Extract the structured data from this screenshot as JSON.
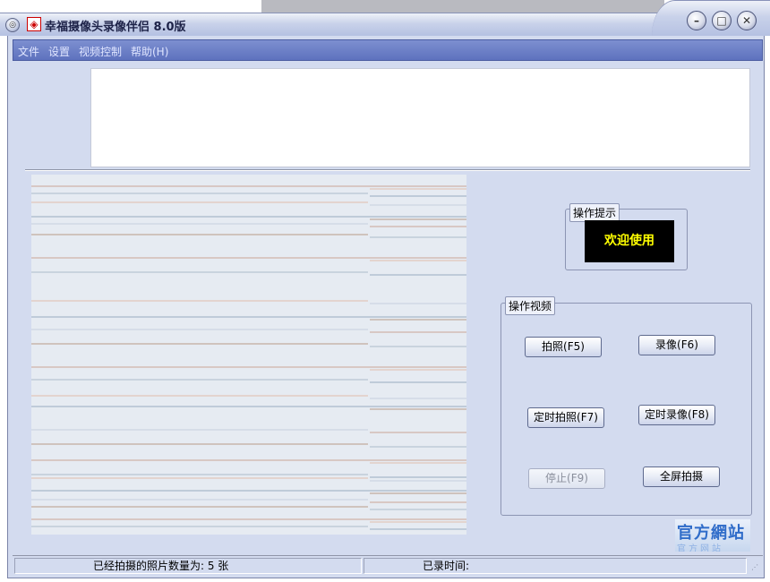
{
  "window": {
    "title": "幸福摄像头录像伴侣 8.0版",
    "app_icon": "◈",
    "system_menu_icon": "◎",
    "controls": {
      "minimize": "–",
      "maximize": "□",
      "close": "✕"
    }
  },
  "menu": {
    "items": [
      {
        "label": "文件"
      },
      {
        "label": "设置"
      },
      {
        "label": "视频控制"
      },
      {
        "label": "帮助(H)"
      }
    ]
  },
  "hint_panel": {
    "title": "操作提示",
    "message": "欢迎使用",
    "message_color": "#ffff00",
    "background_color": "#000000"
  },
  "video_panel": {
    "title": "操作视频",
    "buttons": {
      "photo": "拍照(F5)",
      "record": "录像(F6)",
      "timed_photo": "定时拍照(F7)",
      "timed_record": "定时录像(F8)",
      "stop": "停止(F9)",
      "fullscreen_photo": "全屏拍摄"
    }
  },
  "logo": {
    "text": "官方網站",
    "sub": "官方网站"
  },
  "statusbar": {
    "photo_count": "已经拍摄的照片数量为: 5 张",
    "record_time": "已录时间:"
  },
  "colors": {
    "menubar": "#5e72be",
    "client_bg": "#d3dbef"
  }
}
